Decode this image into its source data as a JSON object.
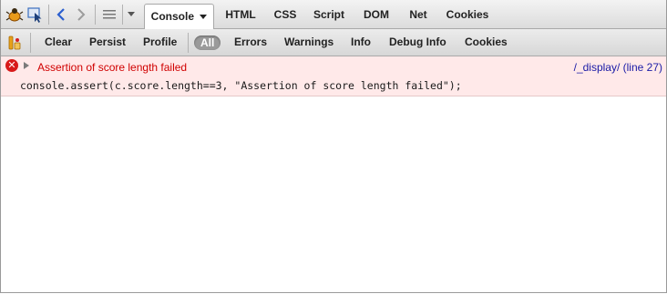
{
  "toolbar": {
    "tabs": [
      {
        "label": "Console",
        "active": true
      },
      {
        "label": "HTML"
      },
      {
        "label": "CSS"
      },
      {
        "label": "Script"
      },
      {
        "label": "DOM"
      },
      {
        "label": "Net"
      },
      {
        "label": "Cookies"
      }
    ]
  },
  "filterbar": {
    "buttons": [
      "Clear",
      "Persist",
      "Profile"
    ],
    "filters": [
      "All",
      "Errors",
      "Warnings",
      "Info",
      "Debug Info",
      "Cookies"
    ],
    "active_filter": "All"
  },
  "console": {
    "entries": [
      {
        "type": "error",
        "message": "Assertion of score length failed",
        "source": "/_display/ (line 27)",
        "code": "console.assert(c.score.length==3, \"Assertion of score length failed\");"
      }
    ]
  },
  "colors": {
    "error_text": "#d00000",
    "error_background": "#ffe9e9",
    "link": "#1a1aa6"
  }
}
